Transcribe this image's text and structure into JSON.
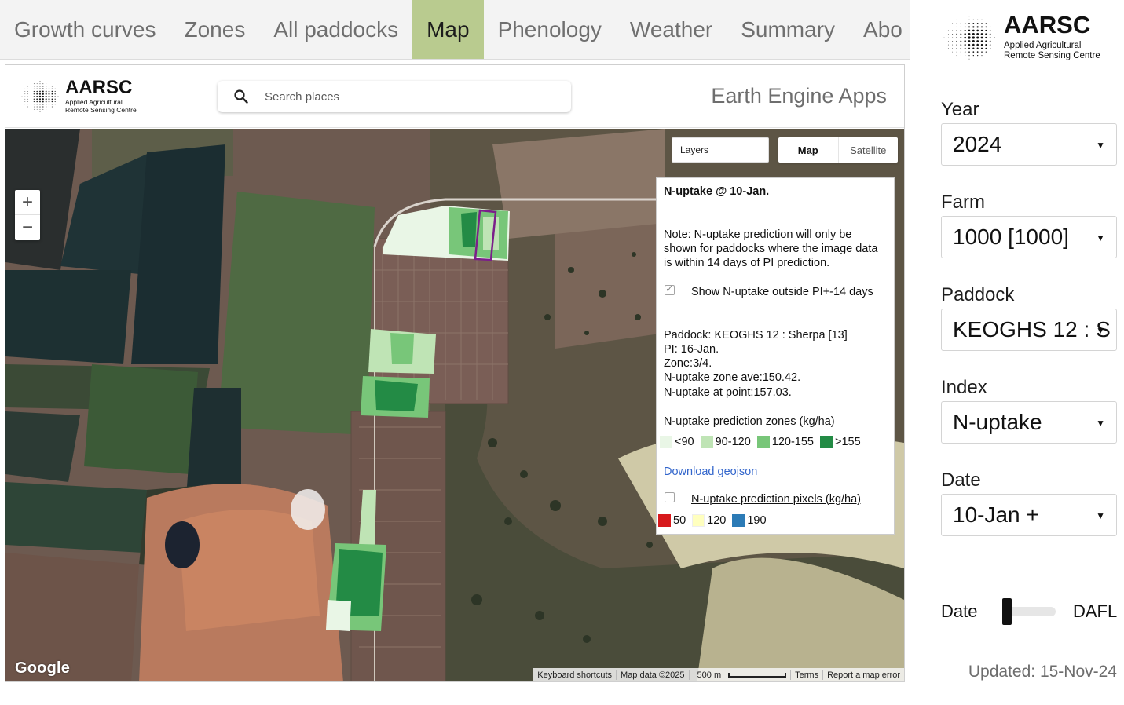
{
  "tabs": [
    {
      "label": "Growth curves",
      "active": false
    },
    {
      "label": "Zones",
      "active": false
    },
    {
      "label": "All paddocks",
      "active": false
    },
    {
      "label": "Map",
      "active": true
    },
    {
      "label": "Phenology",
      "active": false
    },
    {
      "label": "Weather",
      "active": false
    },
    {
      "label": "Summary",
      "active": false
    },
    {
      "label": "Abo",
      "active": false
    }
  ],
  "brand": {
    "name": "AARSC",
    "line1": "Applied Agricultural",
    "line2": "Remote Sensing Centre"
  },
  "sidebar": {
    "year_label": "Year",
    "year_value": "2024",
    "farm_label": "Farm",
    "farm_value": "1000 [1000]",
    "paddock_label": "Paddock",
    "paddock_value": "KEOGHS 12 : S",
    "index_label": "Index",
    "index_value": "N-uptake",
    "date_label": "Date",
    "date_value": "10-Jan +",
    "slider_left_label": "Date",
    "slider_right_label": "DAFL",
    "updated_text": "Updated: 15-Nov-24"
  },
  "app": {
    "search_placeholder": "Search places",
    "title": "Earth Engine Apps"
  },
  "map": {
    "zoom_in": "+",
    "zoom_out": "−",
    "layers_label": "Layers",
    "map_type_map": "Map",
    "map_type_satellite": "Satellite",
    "google_logo": "Google",
    "attrib_shortcuts": "Keyboard shortcuts",
    "attrib_data": "Map data ©2025",
    "attrib_scale": "500 m",
    "attrib_terms": "Terms",
    "attrib_report": "Report a map error"
  },
  "info": {
    "title": "N-uptake @ 10-Jan.",
    "note": "Note: N-uptake prediction will only be shown for paddocks where the image data is within 14 days of PI prediction.",
    "show_outside_label": "Show N-uptake outside PI+-14 days",
    "show_outside_checked": true,
    "paddock_line": "Paddock: KEOGHS 12 : Sherpa [13]",
    "pi_line": "PI: 16-Jan.",
    "zone_line": "Zone:3/4.",
    "zone_ave_line": "N-uptake zone ave:150.42.",
    "point_line": "N-uptake at point:157.03.",
    "zones_heading": "N-uptake prediction zones (kg/ha)",
    "zones_legend": [
      {
        "label": "<90",
        "color": "#e9f6e6"
      },
      {
        "label": "90-120",
        "color": "#bfe4b5"
      },
      {
        "label": "120-155",
        "color": "#78c679"
      },
      {
        "label": ">155",
        "color": "#238b45"
      }
    ],
    "download_link": "Download geojson",
    "pixels_heading": "N-uptake prediction pixels (kg/ha)",
    "pixels_checked": false,
    "pixels_legend": [
      {
        "label": "50",
        "color": "#d7191c"
      },
      {
        "label": "120",
        "color": "#ffffbf"
      },
      {
        "label": "190",
        "color": "#2c7bb6"
      }
    ]
  }
}
